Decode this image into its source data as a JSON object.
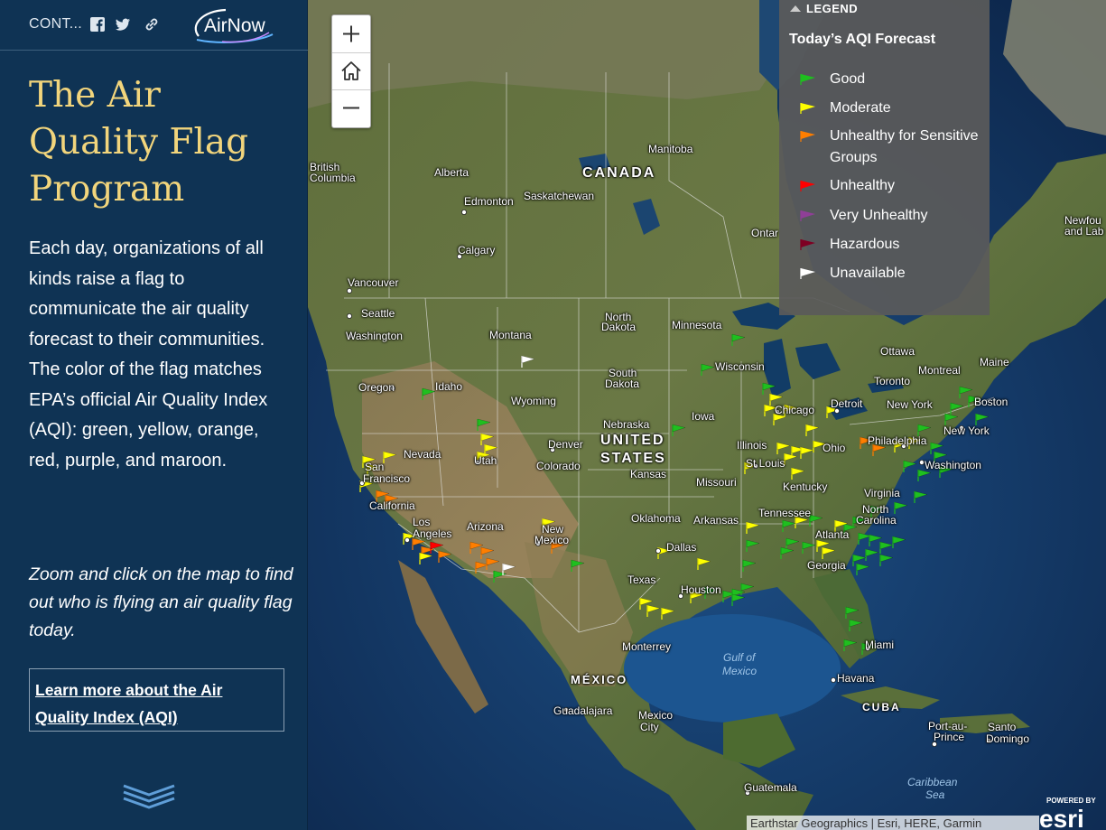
{
  "sidebar": {
    "contents_label": "CONT...",
    "logo_text": "AirNow",
    "title": "The Air Quality Flag Program",
    "description": "Each day, organizations of all kinds raise a flag to communicate the air quality forecast to their communities. The color of the flag matches EPA’s official Air Quality Index (AQI): green, yellow, orange, red, purple, and maroon.",
    "hint": "Zoom and click on the map to find out who is flying an air quality flag today.",
    "learn_more": "Learn more about the Air Quality Index (AQI)"
  },
  "map": {
    "zoom": {
      "in": "+",
      "home": "home",
      "out": "−"
    },
    "legend": {
      "header": "LEGEND",
      "subtitle": "Today’s AQI Forecast",
      "items": [
        {
          "label": "Good",
          "color": "#1fbf1f"
        },
        {
          "label": "Moderate",
          "color": "#ffff00"
        },
        {
          "label": "Unhealthy for Sensitive Groups",
          "color": "#ff7e00"
        },
        {
          "label": "Unhealthy",
          "color": "#ff0000"
        },
        {
          "label": "Very Unhealthy",
          "color": "#8f3f97"
        },
        {
          "label": "Hazardous",
          "color": "#7e0023"
        },
        {
          "label": "Unavailable",
          "color": "#ffffff"
        }
      ]
    },
    "labels": {
      "canada": "CANADA",
      "united_states_1": "UNITED",
      "united_states_2": "STATES",
      "mexico": "MÉXICO",
      "cuba": "CUBA",
      "gulf_1": "Gulf of",
      "gulf_2": "Mexico",
      "caribbean_1": "Caribbean",
      "caribbean_2": "Sea",
      "british_columbia_1": "British",
      "british_columbia_2": "Columbia",
      "alberta": "Alberta",
      "edmonton": "Edmonton",
      "saskatchewan": "Saskatchewan",
      "manitoba": "Manitoba",
      "calgary": "Calgary",
      "vancouver": "Vancouver",
      "ontario": "Ontar",
      "newfoundland_1": "Newfou",
      "newfoundland_2": "and Lab",
      "seattle": "Seattle",
      "washington_state": "Washington",
      "montana": "Montana",
      "north_dakota_1": "North",
      "north_dakota_2": "Dakota",
      "minnesota": "Minnesota",
      "oregon": "Oregon",
      "idaho": "Idaho",
      "south_dakota_1": "South",
      "south_dakota_2": "Dakota",
      "wisconsin": "Wisconsin",
      "wyoming": "Wyoming",
      "ottawa": "Ottawa",
      "montreal": "Montreal",
      "maine": "Maine",
      "toronto": "Toronto",
      "boston": "Boston",
      "detroit": "Detroit",
      "chicago": "Chicago",
      "iowa": "Iowa",
      "nebraska": "Nebraska",
      "new_york_state": "New York",
      "new_york_city": "New York",
      "nevada": "Nevada",
      "utah": "Utah",
      "denver": "Denver",
      "colorado": "Colorado",
      "illinois": "Illinois",
      "ohio": "Ohio",
      "philadelphia": "Philadelphia",
      "san_francisco_1": "San",
      "san_francisco_2": "Francisco",
      "kansas": "Kansas",
      "st_louis": "St Louis",
      "missouri": "Missouri",
      "kentucky": "Kentucky",
      "washington_dc": "Washington",
      "virginia": "Virginia",
      "california": "California",
      "los_angeles_1": "Los",
      "los_angeles_2": "Angeles",
      "arizona": "Arizona",
      "new_mexico_1": "New",
      "new_mexico_2": "Mexico",
      "oklahoma": "Oklahoma",
      "arkansas": "Arkansas",
      "tennessee": "Tennessee",
      "north_carolina_1": "North",
      "north_carolina_2": "Carolina",
      "atlanta": "Atlanta",
      "dallas": "Dallas",
      "texas": "Texas",
      "georgia": "Georgia",
      "houston": "Houston",
      "miami": "Miami",
      "monterrey": "Monterrey",
      "havana": "Havana",
      "guadalajara": "Guadalajara",
      "mexico_city_1": "Mexico",
      "mexico_city_2": "City",
      "port_au_prince_1": "Port-au-",
      "port_au_prince_2": "Prince",
      "santo_domingo_1": "Santo",
      "santo_domingo_2": "Domingo",
      "guatemala": "Guatemala"
    },
    "attribution": "Earthstar Geographics | Esri, HERE, Garmin",
    "esri_powered": "POWERED BY",
    "esri_logo": "esri"
  }
}
